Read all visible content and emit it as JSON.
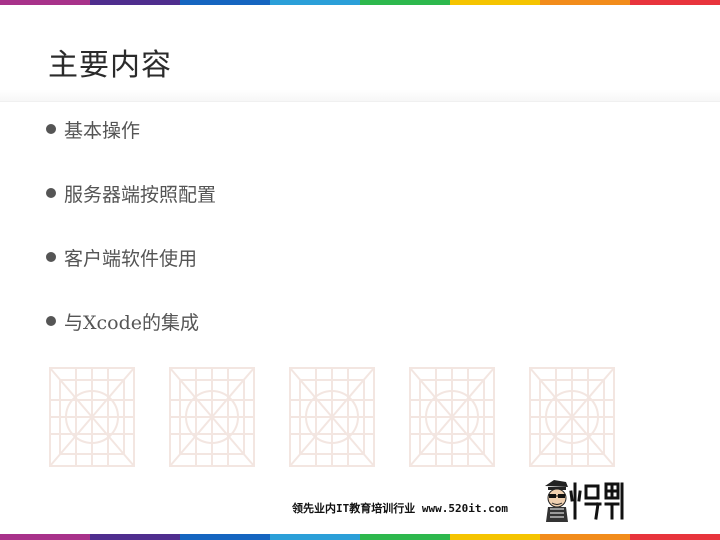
{
  "slide": {
    "title": "主要内容",
    "bullets": [
      {
        "text": "基本操作"
      },
      {
        "text": "服务器端按照配置"
      },
      {
        "text": "客户端软件使用"
      },
      {
        "text": "与Xcode的集成"
      }
    ]
  },
  "footer": {
    "text": "领先业内IT教育培训行业 www.520it.com",
    "logo_icon": "mascot-logo-icon"
  },
  "colors": {
    "stripe": [
      "#a8328a",
      "#4f2e8e",
      "#1565c0",
      "#2b9fd8",
      "#2eb84d",
      "#f5c400",
      "#f28c1b",
      "#e8343c"
    ],
    "title": "#2b2b2b",
    "bullet_text": "#555555",
    "watermark": "#f3e6e1"
  }
}
